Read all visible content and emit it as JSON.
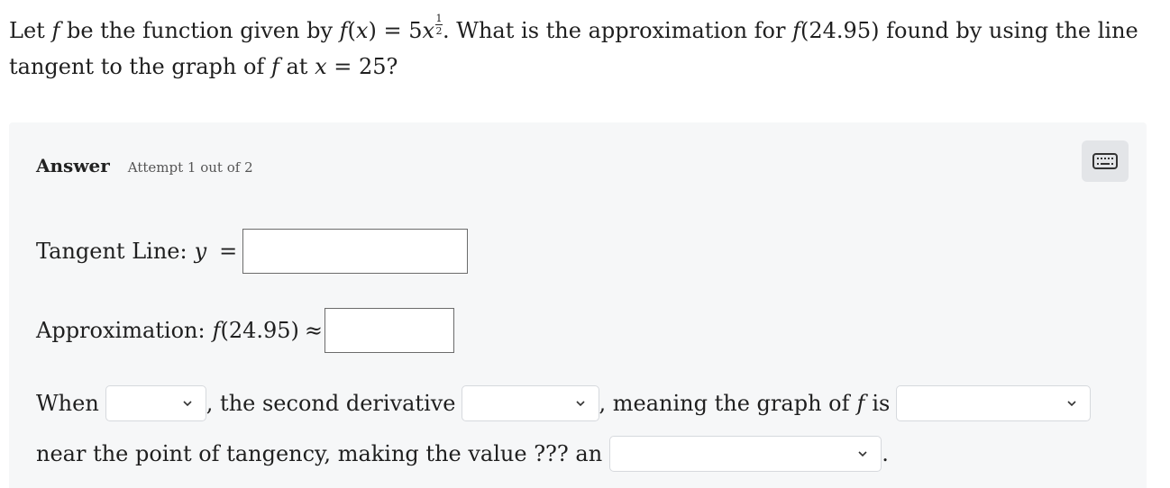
{
  "question": {
    "let": "Let",
    "f": "f",
    "be_the_function": "be the function given by",
    "fx": "f",
    "x": "x",
    "eq": "=",
    "five": "5",
    "exp_num": "1",
    "exp_den": "2",
    "what_is": ". What is the approximation for",
    "arg": "24.95",
    "found_by": "found by using the line tangent to the graph of",
    "at": "at",
    "x_val": "25?"
  },
  "answer": {
    "title": "Answer",
    "attempt": "Attempt 1 out of 2",
    "keyboard_icon": "keyboard-icon"
  },
  "tangent": {
    "label": "Tangent Line:",
    "y": "y",
    "eq": "=",
    "value": ""
  },
  "approx": {
    "label": "Approximation:",
    "f": "f",
    "arg": "(24.95)",
    "approx_sym": "≈",
    "value": ""
  },
  "sentence": {
    "when": "When",
    "second_derivative": ", the second derivative",
    "meaning": ", meaning the graph of",
    "f": "f",
    "is": "is",
    "near": "near the point of tangency, making the value ??? an",
    "period": "."
  },
  "dropdowns": {
    "when_value": "",
    "second_derivative_value": "",
    "concavity_value": "",
    "estimate_value": ""
  }
}
